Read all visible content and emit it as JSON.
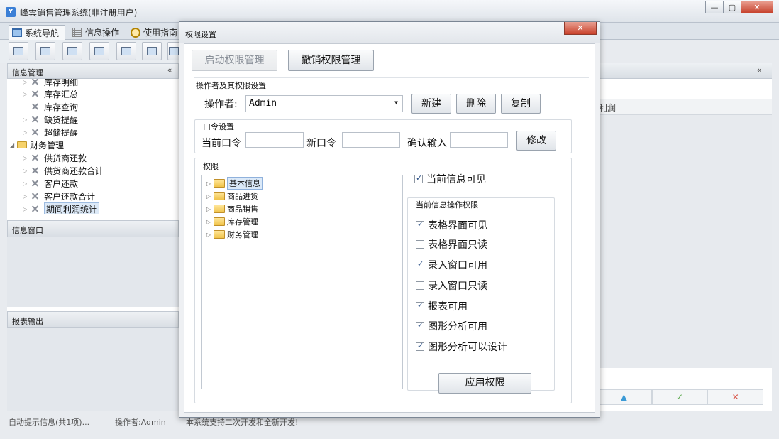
{
  "window": {
    "title": "峰雲销售管理系统(非注册用户)",
    "app_icon": "Y",
    "minimize": "—",
    "maximize": "▢",
    "close": "✕"
  },
  "tabs": [
    {
      "label": "系统导航"
    },
    {
      "label": "信息操作"
    },
    {
      "label": "使用指南"
    }
  ],
  "sidebar": {
    "info_mgmt_title": "信息管理",
    "collapse_symbol": "«",
    "tree": [
      {
        "label": "库存明细",
        "type": "tool",
        "arrow": "▷"
      },
      {
        "label": "库存汇总",
        "type": "tool",
        "arrow": "▷"
      },
      {
        "label": "库存查询",
        "type": "tool",
        "arrow": ""
      },
      {
        "label": "缺货提醒",
        "type": "tool",
        "arrow": "▷"
      },
      {
        "label": "超储提醒",
        "type": "tool",
        "arrow": "▷"
      },
      {
        "label": "财务管理",
        "type": "folder",
        "arrow": "◢"
      },
      {
        "label": "供货商还款",
        "type": "tool",
        "arrow": "▷"
      },
      {
        "label": "供货商还款合计",
        "type": "tool",
        "arrow": "▷"
      },
      {
        "label": "客户还款",
        "type": "tool",
        "arrow": "▷"
      },
      {
        "label": "客户还款合计",
        "type": "tool",
        "arrow": "▷"
      },
      {
        "label": "期间利润统计",
        "type": "tool",
        "arrow": "▷",
        "selected": true
      }
    ],
    "info_window_title": "信息窗口",
    "report_title": "报表输出"
  },
  "right_panel": {
    "expand_symbol": "«",
    "column_label": "利润",
    "buttons": [
      "▲",
      "✓",
      "✕"
    ]
  },
  "statusbar": {
    "hint": "自动提示信息(共1项)...",
    "operator": "操作者:Admin",
    "message": "本系统支持二次开发和全新开发!"
  },
  "dialog": {
    "title": "权限设置",
    "close": "✕",
    "enable_btn": "启动权限管理",
    "revoke_btn": "撤销权限管理",
    "operator_section": "操作者及其权限设置",
    "operator_label": "操作者:",
    "operator_value": "Admin",
    "new_btn": "新建",
    "delete_btn": "删除",
    "copy_btn": "复制",
    "password_section": "口令设置",
    "current_pw_label": "当前口令",
    "new_pw_label": "新口令",
    "confirm_pw_label": "确认输入",
    "modify_btn": "修改",
    "perm_section": "权限",
    "perm_tree": [
      "基本信息",
      "商品进货",
      "商品销售",
      "库存管理",
      "财务管理"
    ],
    "current_visible": "当前信息可见",
    "ops_section": "当前信息操作权限",
    "options": [
      {
        "label": "表格界面可见",
        "checked": true
      },
      {
        "label": "表格界面只读",
        "checked": false
      },
      {
        "label": "录入窗口可用",
        "checked": true
      },
      {
        "label": "录入窗口只读",
        "checked": false
      },
      {
        "label": "报表可用",
        "checked": true
      },
      {
        "label": "图形分析可用",
        "checked": true
      },
      {
        "label": "图形分析可以设计",
        "checked": true
      }
    ],
    "apply_btn": "应用权限"
  },
  "colors": {
    "accent": "#3b7fd6",
    "close_red": "#c7432e",
    "folder_yellow": "#f0c34a"
  }
}
